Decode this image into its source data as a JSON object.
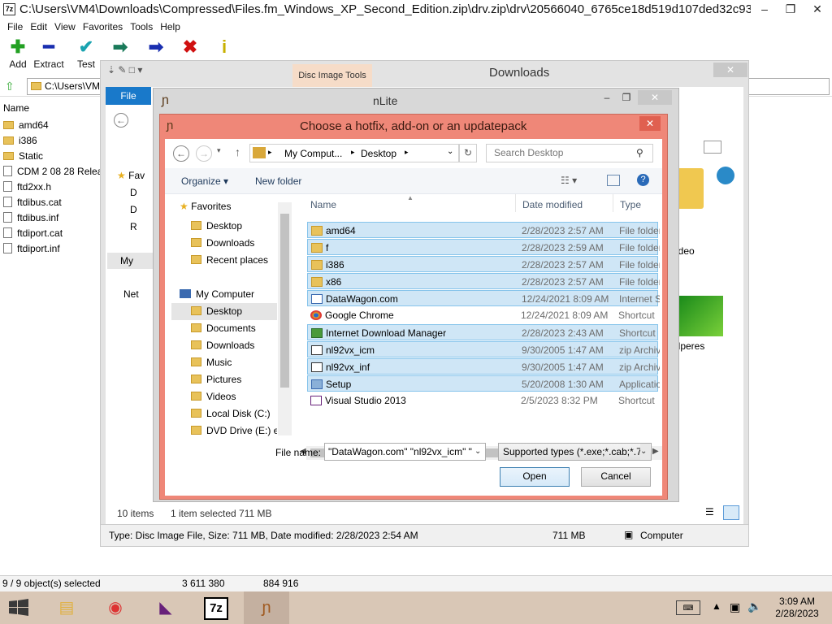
{
  "zip": {
    "title": "C:\\Users\\VM4\\Downloads\\Compressed\\Files.fm_Windows_XP_Second_Edition.zip\\drv.zip\\drv\\20566040_6765ce18d519d107ded32c93...",
    "app_icon": "7z",
    "menu": [
      "File",
      "Edit",
      "View",
      "Favorites",
      "Tools",
      "Help"
    ],
    "toolbar": [
      {
        "label": "Add",
        "icon": "plus-icon",
        "glyph": "✚",
        "color": "#22a022"
      },
      {
        "label": "Extract",
        "icon": "minus-icon",
        "glyph": "━",
        "color": "#1a2fb0"
      },
      {
        "label": "Test",
        "icon": "check-icon",
        "glyph": "✔",
        "color": "#1aa3b0"
      },
      {
        "label": "",
        "icon": "copy-arrow-icon",
        "glyph": "➡",
        "color": "#1a7a5a"
      },
      {
        "label": "",
        "icon": "move-arrow-icon",
        "glyph": "➡",
        "color": "#1a2fb0"
      },
      {
        "label": "",
        "icon": "delete-icon",
        "glyph": "✖",
        "color": "#d01010"
      },
      {
        "label": "",
        "icon": "info-icon",
        "glyph": "i",
        "color": "#c8b000"
      }
    ],
    "address": "C:\\Users\\VM",
    "column": "Name",
    "files": [
      {
        "name": "amd64",
        "type": "folder"
      },
      {
        "name": "i386",
        "type": "folder"
      },
      {
        "name": "Static",
        "type": "folder"
      },
      {
        "name": "CDM 2 08 28 Relea",
        "type": "file"
      },
      {
        "name": "ftd2xx.h",
        "type": "file"
      },
      {
        "name": "ftdibus.cat",
        "type": "file"
      },
      {
        "name": "ftdibus.inf",
        "type": "file"
      },
      {
        "name": "ftdiport.cat",
        "type": "file"
      },
      {
        "name": "ftdiport.inf",
        "type": "file"
      }
    ],
    "status": [
      "9 / 9 object(s) selected",
      "3 611 380",
      "884 916"
    ]
  },
  "downloads": {
    "title": "Downloads",
    "ribbon_context": "Disc Image Tools",
    "ribbon_file": "File",
    "nav": [
      "Fav",
      "D",
      "D",
      "R",
      "My",
      "Net"
    ],
    "right_items": [
      "ideo",
      "llperes"
    ],
    "items_count": "10 items",
    "selected": "1 item selected  711 MB",
    "status": "Type: Disc Image File, Size: 711 MB, Date modified: 2/28/2023 2:54 AM",
    "status_size": "711 MB",
    "status_loc": "Computer"
  },
  "nlite": {
    "title": "nLite"
  },
  "dialog": {
    "title": "Choose a hotfix, add-on or an updatepack",
    "breadcrumb": [
      "My Comput...",
      "Desktop"
    ],
    "search_placeholder": "Search Desktop",
    "organize": "Organize ▾",
    "new_folder": "New folder",
    "cols": [
      "Name",
      "Date modified",
      "Type"
    ],
    "favorites": "Favorites",
    "nav": [
      {
        "label": "Desktop",
        "indent": 1
      },
      {
        "label": "Downloads",
        "indent": 1
      },
      {
        "label": "Recent places",
        "indent": 1
      },
      {
        "label": "",
        "indent": 0
      },
      {
        "label": "My Computer",
        "indent": 0
      },
      {
        "label": "Desktop",
        "indent": 1,
        "selected": true
      },
      {
        "label": "Documents",
        "indent": 1
      },
      {
        "label": "Downloads",
        "indent": 1
      },
      {
        "label": "Music",
        "indent": 1
      },
      {
        "label": "Pictures",
        "indent": 1
      },
      {
        "label": "Videos",
        "indent": 1
      },
      {
        "label": "Local Disk (C:)",
        "indent": 1
      },
      {
        "label": "DVD Drive (E:) en",
        "indent": 1
      }
    ],
    "files": [
      {
        "name": "amd64",
        "date": "2/28/2023 2:57 AM",
        "type": "File folder",
        "kind": "folder",
        "sel": true
      },
      {
        "name": "f",
        "date": "2/28/2023 2:59 AM",
        "type": "File folder",
        "kind": "folder",
        "sel": true
      },
      {
        "name": "i386",
        "date": "2/28/2023 2:57 AM",
        "type": "File folder",
        "kind": "folder",
        "sel": true
      },
      {
        "name": "x86",
        "date": "2/28/2023 2:57 AM",
        "type": "File folder",
        "kind": "folder",
        "sel": true
      },
      {
        "name": "DataWagon.com",
        "date": "12/24/2021 8:09 AM",
        "type": "Internet S",
        "kind": "link",
        "sel": true
      },
      {
        "name": "Google Chrome",
        "date": "12/24/2021 8:09 AM",
        "type": "Shortcut",
        "kind": "chrome",
        "sel": false
      },
      {
        "name": "Internet Download Manager",
        "date": "2/28/2023 2:43 AM",
        "type": "Shortcut",
        "kind": "idm",
        "sel": true
      },
      {
        "name": "nl92vx_icm",
        "date": "9/30/2005 1:47 AM",
        "type": "zip Archiv",
        "kind": "zip",
        "sel": true
      },
      {
        "name": "nl92vx_inf",
        "date": "9/30/2005 1:47 AM",
        "type": "zip Archiv",
        "kind": "zip",
        "sel": true
      },
      {
        "name": "Setup",
        "date": "5/20/2008 1:30 AM",
        "type": "Applicatio",
        "kind": "app",
        "sel": true
      },
      {
        "name": "Visual Studio 2013",
        "date": "2/5/2023 8:32 PM",
        "type": "Shortcut",
        "kind": "vs",
        "sel": false
      }
    ],
    "filename_label": "File name:",
    "filename_value": "\"DataWagon.com\" \"nl92vx_icm\" \"",
    "filetype": "Supported types (*.exe;*.cab;*.7",
    "open": "Open",
    "cancel": "Cancel"
  },
  "taskbar": {
    "apps": [
      {
        "icon": "file-explorer-icon",
        "glyph": "▤",
        "color": "#e0b040"
      },
      {
        "icon": "chrome-icon",
        "glyph": "◉",
        "color": "#d33"
      },
      {
        "icon": "visual-studio-icon",
        "glyph": "◣",
        "color": "#68217a"
      },
      {
        "icon": "7zip-icon",
        "glyph": "7z",
        "color": "#000"
      },
      {
        "icon": "nlite-icon",
        "glyph": "ɲ",
        "color": "#a05a20"
      }
    ],
    "time": "3:09 AM",
    "date": "2/28/2023"
  }
}
